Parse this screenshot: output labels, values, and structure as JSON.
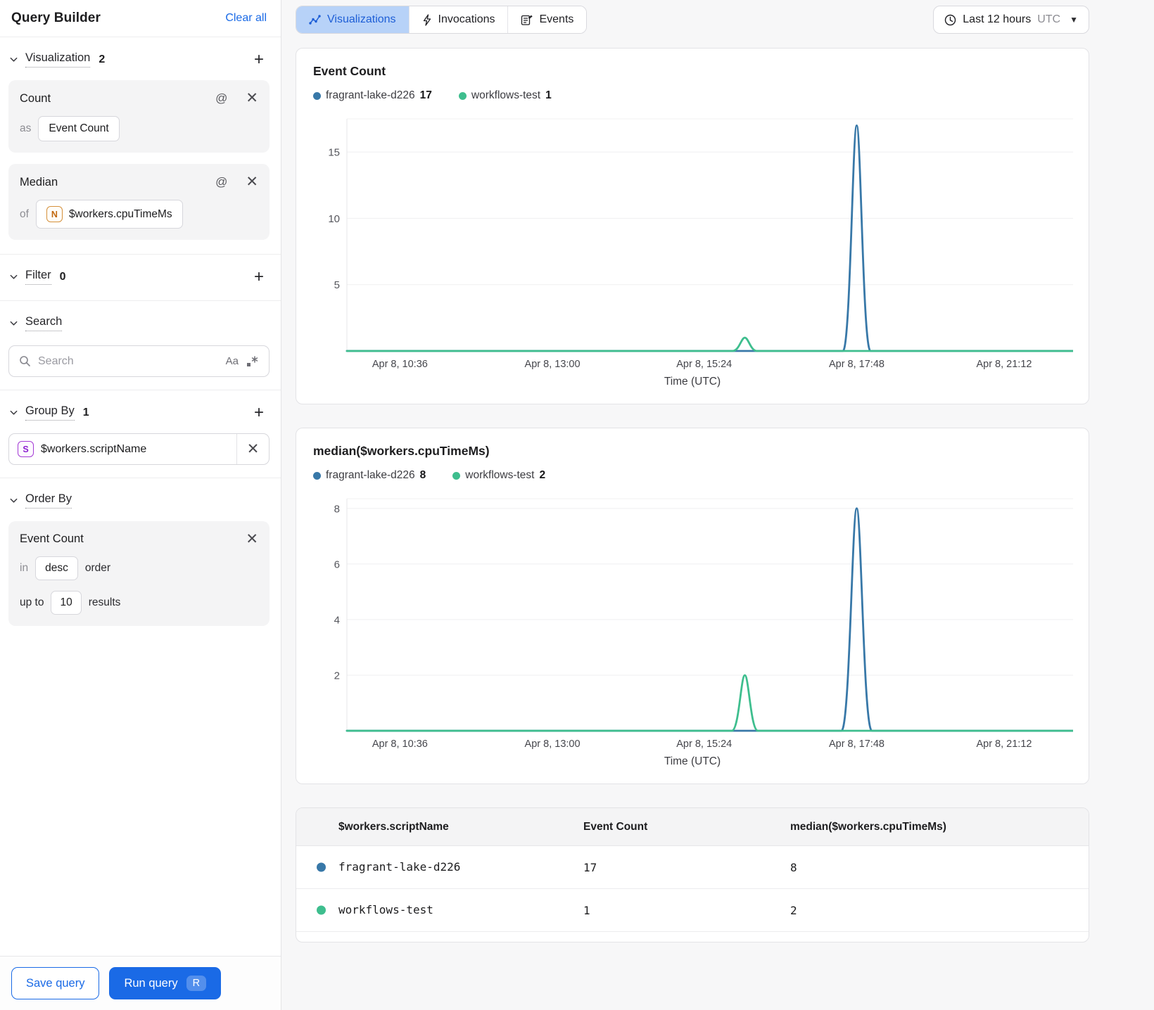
{
  "colors": {
    "accent_blue": "#1a6ae6",
    "active_tab_bg": "#b7d2f8",
    "active_tab_text": "#1d5ed6",
    "series_blue": "#3878a8",
    "series_green": "#3ebe8e"
  },
  "sidebar": {
    "title": "Query Builder",
    "clear_all": "Clear all",
    "visualization": {
      "label": "Visualization",
      "count": "2",
      "cards": [
        {
          "title": "Count",
          "prefix": "as",
          "value": "Event Count"
        },
        {
          "title": "Median",
          "prefix": "of",
          "chip": "N",
          "value": "$workers.cpuTimeMs"
        }
      ]
    },
    "filter": {
      "label": "Filter",
      "count": "0"
    },
    "search": {
      "label": "Search",
      "placeholder": "Search",
      "case_label": "Aa"
    },
    "group_by": {
      "label": "Group By",
      "count": "1",
      "item": {
        "chip": "S",
        "value": "$workers.scriptName"
      }
    },
    "order_by": {
      "label": "Order By",
      "field": "Event Count",
      "in_label": "in",
      "direction": "desc",
      "order_label": "order",
      "up_to_label": "up to",
      "limit": "10",
      "results_label": "results"
    },
    "footer": {
      "save": "Save query",
      "run": "Run query",
      "shortcut": "R"
    }
  },
  "topbar": {
    "tabs": [
      {
        "label": "Visualizations"
      },
      {
        "label": "Invocations"
      },
      {
        "label": "Events"
      }
    ],
    "time_range": {
      "label": "Last 12 hours",
      "timezone": "UTC"
    }
  },
  "chart_data": [
    {
      "type": "line",
      "title": "Event Count",
      "xlabel": "Time (UTC)",
      "ylim": [
        0,
        17.5
      ],
      "yticks": [
        5,
        10,
        15
      ],
      "grid": true,
      "legend_position": "top",
      "xticks": [
        {
          "label": "Apr 8, 10:36",
          "frac": 0.073
        },
        {
          "label": "Apr 8, 13:00",
          "frac": 0.283
        },
        {
          "label": "Apr 8, 15:24",
          "frac": 0.492
        },
        {
          "label": "Apr 8, 17:48",
          "frac": 0.702
        },
        {
          "label": "Apr 8, 21:12",
          "frac": 0.905
        }
      ],
      "legend": [
        {
          "name": "fragrant-lake-d226",
          "value": "17",
          "color": "#3878a8"
        },
        {
          "name": "workflows-test",
          "value": "1",
          "color": "#3ebe8e"
        }
      ],
      "series": [
        {
          "name": "fragrant-lake-d226",
          "color": "#3878a8",
          "baseline": 0,
          "spikes": [
            {
              "center": 0.702,
              "half_width": 0.019,
              "peak": 17,
              "peak_time": "Apr 8, 17:48"
            }
          ]
        },
        {
          "name": "workflows-test",
          "color": "#3ebe8e",
          "baseline": 0,
          "spikes": [
            {
              "center": 0.548,
              "half_width": 0.017,
              "peak": 1,
              "peak_time": "Apr 8, ~15:50"
            }
          ]
        }
      ]
    },
    {
      "type": "line",
      "title": "median($workers.cpuTimeMs)",
      "xlabel": "Time (UTC)",
      "ylim": [
        0,
        8.35
      ],
      "yticks": [
        2,
        4,
        6,
        8
      ],
      "grid": true,
      "legend_position": "top",
      "xticks": [
        {
          "label": "Apr 8, 10:36",
          "frac": 0.073
        },
        {
          "label": "Apr 8, 13:00",
          "frac": 0.283
        },
        {
          "label": "Apr 8, 15:24",
          "frac": 0.492
        },
        {
          "label": "Apr 8, 17:48",
          "frac": 0.702
        },
        {
          "label": "Apr 8, 21:12",
          "frac": 0.905
        }
      ],
      "legend": [
        {
          "name": "fragrant-lake-d226",
          "value": "8",
          "color": "#3878a8"
        },
        {
          "name": "workflows-test",
          "value": "2",
          "color": "#3ebe8e"
        }
      ],
      "series": [
        {
          "name": "fragrant-lake-d226",
          "color": "#3878a8",
          "baseline": 0,
          "spikes": [
            {
              "center": 0.702,
              "half_width": 0.021,
              "peak": 8,
              "peak_time": "Apr 8, 17:48"
            }
          ]
        },
        {
          "name": "workflows-test",
          "color": "#3ebe8e",
          "baseline": 0,
          "spikes": [
            {
              "center": 0.548,
              "half_width": 0.018,
              "peak": 2,
              "peak_time": "Apr 8, ~15:50"
            }
          ]
        }
      ]
    }
  ],
  "table": {
    "columns": [
      "$workers.scriptName",
      "Event Count",
      "median($workers.cpuTimeMs)"
    ],
    "rows": [
      {
        "color": "#3878a8",
        "name": "fragrant-lake-d226",
        "event_count": "17",
        "median": "8"
      },
      {
        "color": "#3ebe8e",
        "name": "workflows-test",
        "event_count": "1",
        "median": "2"
      }
    ]
  }
}
